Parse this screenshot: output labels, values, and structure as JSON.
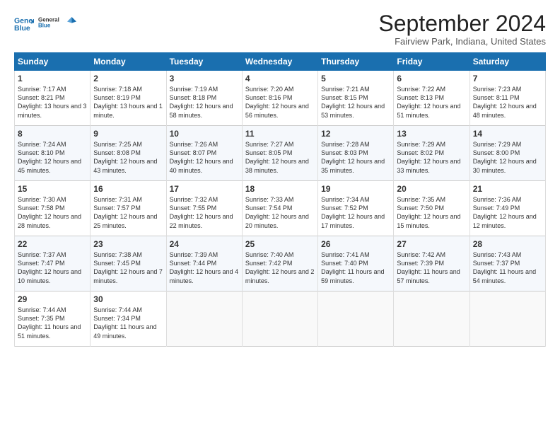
{
  "logo": {
    "line1": "General",
    "line2": "Blue"
  },
  "title": "September 2024",
  "subtitle": "Fairview Park, Indiana, United States",
  "days_header": [
    "Sunday",
    "Monday",
    "Tuesday",
    "Wednesday",
    "Thursday",
    "Friday",
    "Saturday"
  ],
  "weeks": [
    [
      {
        "day": "1",
        "sunrise": "Sunrise: 7:17 AM",
        "sunset": "Sunset: 8:21 PM",
        "daylight": "Daylight: 13 hours and 3 minutes."
      },
      {
        "day": "2",
        "sunrise": "Sunrise: 7:18 AM",
        "sunset": "Sunset: 8:19 PM",
        "daylight": "Daylight: 13 hours and 1 minute."
      },
      {
        "day": "3",
        "sunrise": "Sunrise: 7:19 AM",
        "sunset": "Sunset: 8:18 PM",
        "daylight": "Daylight: 12 hours and 58 minutes."
      },
      {
        "day": "4",
        "sunrise": "Sunrise: 7:20 AM",
        "sunset": "Sunset: 8:16 PM",
        "daylight": "Daylight: 12 hours and 56 minutes."
      },
      {
        "day": "5",
        "sunrise": "Sunrise: 7:21 AM",
        "sunset": "Sunset: 8:15 PM",
        "daylight": "Daylight: 12 hours and 53 minutes."
      },
      {
        "day": "6",
        "sunrise": "Sunrise: 7:22 AM",
        "sunset": "Sunset: 8:13 PM",
        "daylight": "Daylight: 12 hours and 51 minutes."
      },
      {
        "day": "7",
        "sunrise": "Sunrise: 7:23 AM",
        "sunset": "Sunset: 8:11 PM",
        "daylight": "Daylight: 12 hours and 48 minutes."
      }
    ],
    [
      {
        "day": "8",
        "sunrise": "Sunrise: 7:24 AM",
        "sunset": "Sunset: 8:10 PM",
        "daylight": "Daylight: 12 hours and 45 minutes."
      },
      {
        "day": "9",
        "sunrise": "Sunrise: 7:25 AM",
        "sunset": "Sunset: 8:08 PM",
        "daylight": "Daylight: 12 hours and 43 minutes."
      },
      {
        "day": "10",
        "sunrise": "Sunrise: 7:26 AM",
        "sunset": "Sunset: 8:07 PM",
        "daylight": "Daylight: 12 hours and 40 minutes."
      },
      {
        "day": "11",
        "sunrise": "Sunrise: 7:27 AM",
        "sunset": "Sunset: 8:05 PM",
        "daylight": "Daylight: 12 hours and 38 minutes."
      },
      {
        "day": "12",
        "sunrise": "Sunrise: 7:28 AM",
        "sunset": "Sunset: 8:03 PM",
        "daylight": "Daylight: 12 hours and 35 minutes."
      },
      {
        "day": "13",
        "sunrise": "Sunrise: 7:29 AM",
        "sunset": "Sunset: 8:02 PM",
        "daylight": "Daylight: 12 hours and 33 minutes."
      },
      {
        "day": "14",
        "sunrise": "Sunrise: 7:29 AM",
        "sunset": "Sunset: 8:00 PM",
        "daylight": "Daylight: 12 hours and 30 minutes."
      }
    ],
    [
      {
        "day": "15",
        "sunrise": "Sunrise: 7:30 AM",
        "sunset": "Sunset: 7:58 PM",
        "daylight": "Daylight: 12 hours and 28 minutes."
      },
      {
        "day": "16",
        "sunrise": "Sunrise: 7:31 AM",
        "sunset": "Sunset: 7:57 PM",
        "daylight": "Daylight: 12 hours and 25 minutes."
      },
      {
        "day": "17",
        "sunrise": "Sunrise: 7:32 AM",
        "sunset": "Sunset: 7:55 PM",
        "daylight": "Daylight: 12 hours and 22 minutes."
      },
      {
        "day": "18",
        "sunrise": "Sunrise: 7:33 AM",
        "sunset": "Sunset: 7:54 PM",
        "daylight": "Daylight: 12 hours and 20 minutes."
      },
      {
        "day": "19",
        "sunrise": "Sunrise: 7:34 AM",
        "sunset": "Sunset: 7:52 PM",
        "daylight": "Daylight: 12 hours and 17 minutes."
      },
      {
        "day": "20",
        "sunrise": "Sunrise: 7:35 AM",
        "sunset": "Sunset: 7:50 PM",
        "daylight": "Daylight: 12 hours and 15 minutes."
      },
      {
        "day": "21",
        "sunrise": "Sunrise: 7:36 AM",
        "sunset": "Sunset: 7:49 PM",
        "daylight": "Daylight: 12 hours and 12 minutes."
      }
    ],
    [
      {
        "day": "22",
        "sunrise": "Sunrise: 7:37 AM",
        "sunset": "Sunset: 7:47 PM",
        "daylight": "Daylight: 12 hours and 10 minutes."
      },
      {
        "day": "23",
        "sunrise": "Sunrise: 7:38 AM",
        "sunset": "Sunset: 7:45 PM",
        "daylight": "Daylight: 12 hours and 7 minutes."
      },
      {
        "day": "24",
        "sunrise": "Sunrise: 7:39 AM",
        "sunset": "Sunset: 7:44 PM",
        "daylight": "Daylight: 12 hours and 4 minutes."
      },
      {
        "day": "25",
        "sunrise": "Sunrise: 7:40 AM",
        "sunset": "Sunset: 7:42 PM",
        "daylight": "Daylight: 12 hours and 2 minutes."
      },
      {
        "day": "26",
        "sunrise": "Sunrise: 7:41 AM",
        "sunset": "Sunset: 7:40 PM",
        "daylight": "Daylight: 11 hours and 59 minutes."
      },
      {
        "day": "27",
        "sunrise": "Sunrise: 7:42 AM",
        "sunset": "Sunset: 7:39 PM",
        "daylight": "Daylight: 11 hours and 57 minutes."
      },
      {
        "day": "28",
        "sunrise": "Sunrise: 7:43 AM",
        "sunset": "Sunset: 7:37 PM",
        "daylight": "Daylight: 11 hours and 54 minutes."
      }
    ],
    [
      {
        "day": "29",
        "sunrise": "Sunrise: 7:44 AM",
        "sunset": "Sunset: 7:35 PM",
        "daylight": "Daylight: 11 hours and 51 minutes."
      },
      {
        "day": "30",
        "sunrise": "Sunrise: 7:44 AM",
        "sunset": "Sunset: 7:34 PM",
        "daylight": "Daylight: 11 hours and 49 minutes."
      },
      null,
      null,
      null,
      null,
      null
    ]
  ]
}
